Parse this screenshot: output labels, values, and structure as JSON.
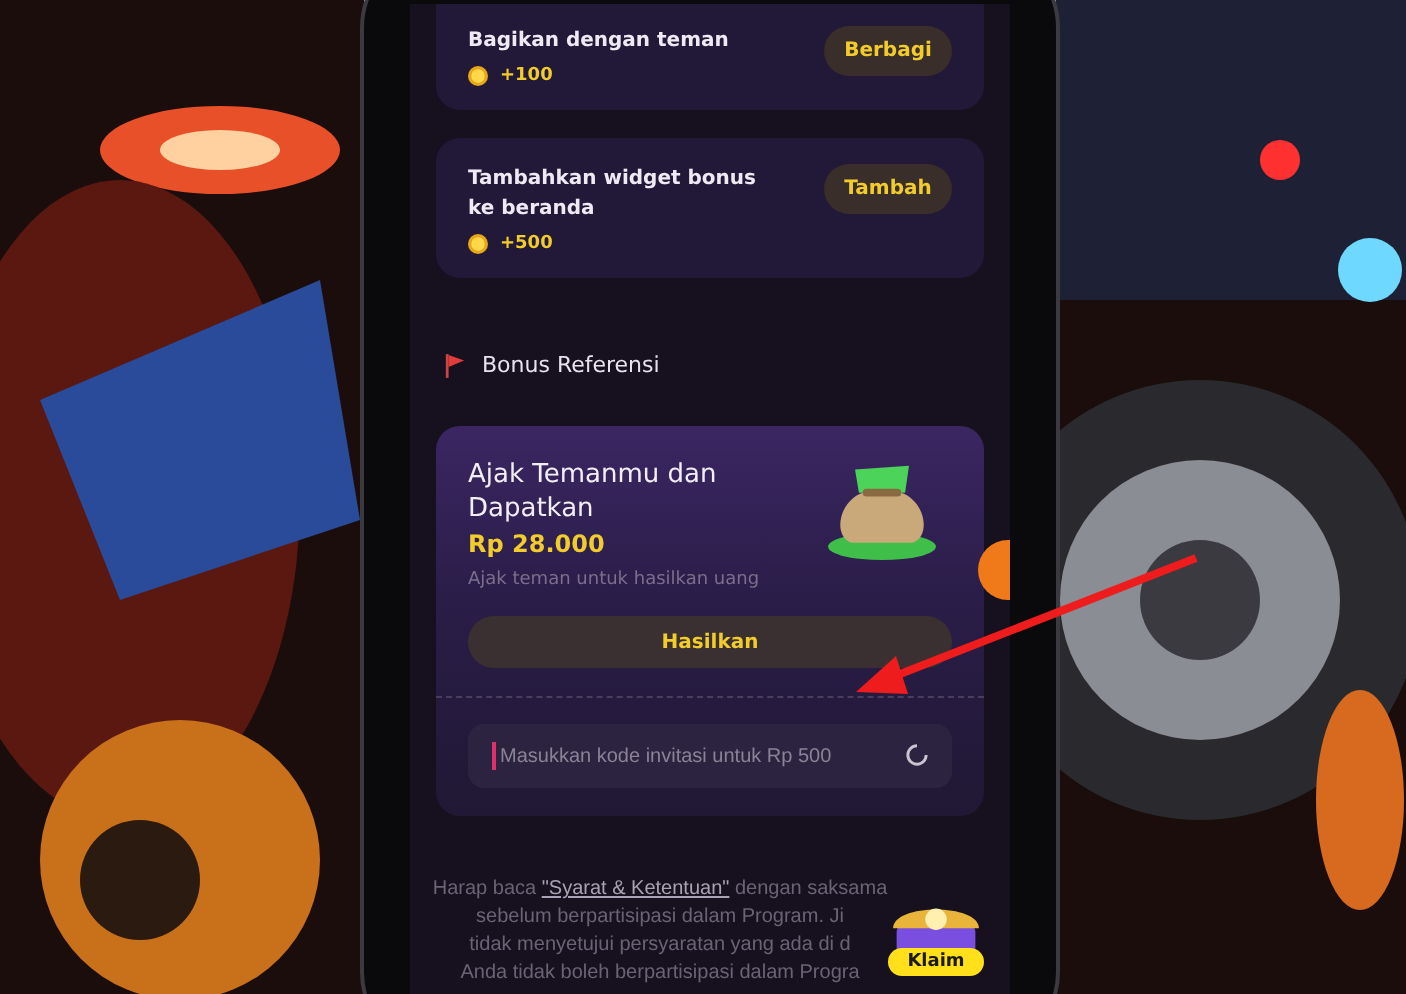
{
  "tasks": [
    {
      "title": "Bagikan dengan teman",
      "reward": "+100",
      "button": "Berbagi"
    },
    {
      "title": "Tambahkan widget bonus ke beranda",
      "reward": "+500",
      "button": "Tambah"
    }
  ],
  "section": {
    "title": "Bonus Referensi"
  },
  "referral": {
    "title": "Ajak Temanmu dan Dapatkan",
    "amount": "Rp 28.000",
    "subtitle": "Ajak teman untuk hasilkan uang",
    "button": "Hasilkan",
    "code_field": {
      "placeholder": "Masukkan kode invitasi untuk Rp 500"
    }
  },
  "terms": {
    "before": "Harap baca",
    "link": "\"Syarat & Ketentuan\"",
    "after": "dengan saksama",
    "lines": [
      "sebelum berpartisipasi dalam Program. Ji",
      "tidak menyetujui persyaratan yang ada di d",
      "Anda tidak boleh berpartisipasi dalam Progra"
    ]
  },
  "claim_badge": {
    "label": "Klaim"
  }
}
